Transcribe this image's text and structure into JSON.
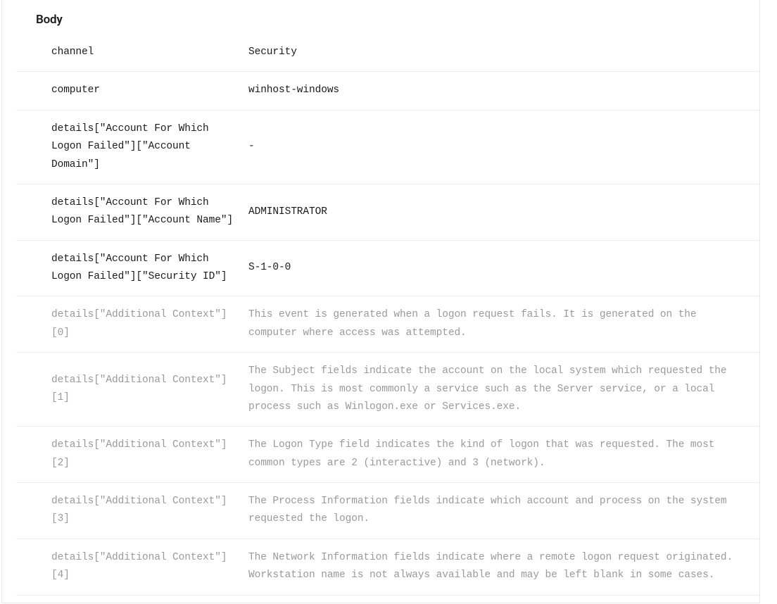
{
  "section_title": "Body",
  "rows": [
    {
      "key": "channel",
      "value": "Security",
      "muted": false
    },
    {
      "key": "computer",
      "value": "winhost-windows",
      "muted": false
    },
    {
      "key": "details[\"Account For Which Logon Failed\"][\"Account Domain\"]",
      "value": "-",
      "muted": false
    },
    {
      "key": "details[\"Account For Which Logon Failed\"][\"Account Name\"]",
      "value": "ADMINISTRATOR",
      "muted": false
    },
    {
      "key": "details[\"Account For Which Logon Failed\"][\"Security ID\"]",
      "value": "S-1-0-0",
      "muted": false
    },
    {
      "key": "details[\"Additional Context\"][0]",
      "value": "This event is generated when a logon request fails. It is generated on the computer where access was attempted.",
      "muted": true
    },
    {
      "key": "details[\"Additional Context\"][1]",
      "value": "The Subject fields indicate the account on the local system which requested the logon. This is most commonly a service such as the Server service, or a local process such as Winlogon.exe or Services.exe.",
      "muted": true
    },
    {
      "key": "details[\"Additional Context\"][2]",
      "value": "The Logon Type field indicates the kind of logon that was requested. The most common types are 2 (interactive) and 3 (network).",
      "muted": true
    },
    {
      "key": "details[\"Additional Context\"][3]",
      "value": "The Process Information fields indicate which account and process on the system requested the logon.",
      "muted": true
    },
    {
      "key": "details[\"Additional Context\"][4]",
      "value": "The Network Information fields indicate where a remote logon request originated. Workstation name is not always available and may be left blank in some cases.",
      "muted": true
    }
  ]
}
